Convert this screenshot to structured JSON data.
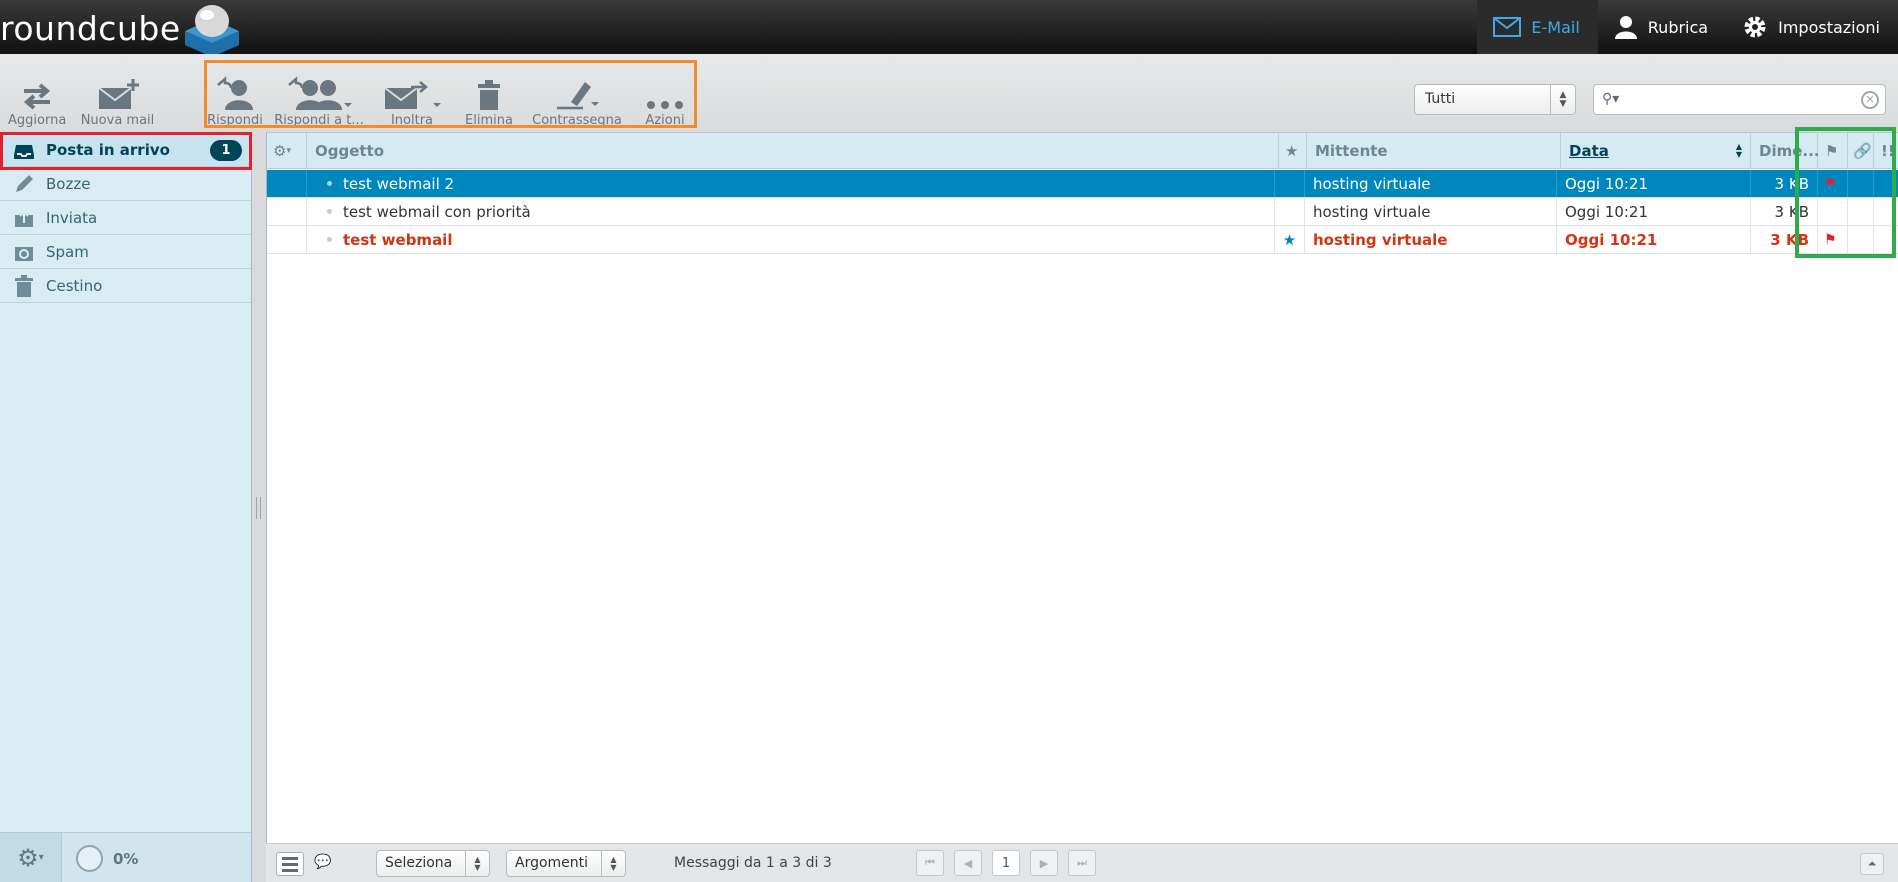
{
  "app": {
    "logo_text": "roundcube"
  },
  "topnav": [
    {
      "label": "E-Mail",
      "icon": "envelope-icon",
      "active": true
    },
    {
      "label": "Rubrica",
      "icon": "person-icon",
      "active": false
    },
    {
      "label": "Impostazioni",
      "icon": "gear-icon",
      "active": false
    }
  ],
  "toolbar": {
    "refresh": "Aggiorna",
    "compose": "Nuova mail",
    "reply": "Rispondi",
    "reply_all": "Rispondi a t...",
    "forward": "Inoltra",
    "delete": "Elimina",
    "mark": "Contrassegna",
    "actions": "Azioni"
  },
  "filter": {
    "selected": "Tutti"
  },
  "search": {
    "value": "",
    "placeholder": ""
  },
  "folders": [
    {
      "label": "Posta in arrivo",
      "icon": "inbox-icon",
      "unread": "1",
      "selected": true
    },
    {
      "label": "Bozze",
      "icon": "pencil-icon",
      "selected": false
    },
    {
      "label": "Inviata",
      "icon": "sent-icon",
      "selected": false
    },
    {
      "label": "Spam",
      "icon": "spam-icon",
      "selected": false
    },
    {
      "label": "Cestino",
      "icon": "trash-icon",
      "selected": false
    }
  ],
  "quota": {
    "percent": "0%"
  },
  "columns": {
    "subject": "Oggetto",
    "from": "Mittente",
    "date": "Data",
    "size": "Dime..."
  },
  "messages": [
    {
      "subject": "test webmail 2",
      "from": "hosting virtuale",
      "date": "Oggi 10:21",
      "size": "3 KB",
      "flagged": true,
      "starred": false,
      "unread": false,
      "selected": true
    },
    {
      "subject": "test webmail con priorità",
      "from": "hosting virtuale",
      "date": "Oggi 10:21",
      "size": "3 KB",
      "flagged": false,
      "starred": false,
      "unread": false,
      "selected": false
    },
    {
      "subject": "test webmail",
      "from": "hosting virtuale",
      "date": "Oggi 10:21",
      "size": "3 KB",
      "flagged": true,
      "starred": true,
      "unread": true,
      "selected": false
    }
  ],
  "listfooter": {
    "select": "Seleziona",
    "threads": "Argomenti",
    "count": "Messaggi da 1 a 3 di 3",
    "page": "1"
  },
  "colors": {
    "accent": "#0087be",
    "unread": "#d33512",
    "highlight_toolbar": "#f28c2c",
    "highlight_folder": "#e0222c",
    "highlight_columns": "#2fac49"
  }
}
